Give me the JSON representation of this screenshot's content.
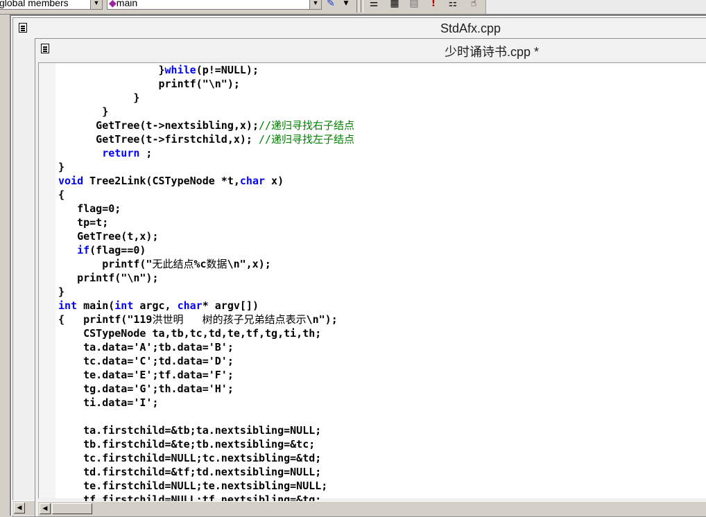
{
  "toolbar": {
    "scope_combo": "global members",
    "function_combo": "main",
    "icons": [
      "wizard-icon",
      "dropdown-arrow-icon",
      "stack-icon",
      "calculator-icon",
      "grid-icon",
      "exclamation-icon",
      "list-icon",
      "hand-icon"
    ]
  },
  "windows": {
    "back_title": "StdAfx.cpp",
    "front_title": "少时诵诗书.cpp *"
  },
  "code": {
    "lines": [
      "                }while(p!=NULL);",
      "                printf(\"\\n\");",
      "            }",
      "       }",
      "      GetTree(t->nextsibling,x);//递归寻找右子结点",
      "      GetTree(t->firstchild,x); //递归寻找左子结点",
      "       return ;",
      "}",
      "void Tree2Link(CSTypeNode *t,char x)",
      "{",
      "   flag=0;",
      "   tp=t;",
      "   GetTree(t,x);",
      "   if(flag==0)",
      "       printf(\"无此结点%c数据\\n\",x);",
      "   printf(\"\\n\");",
      "}",
      "int main(int argc, char* argv[])",
      "{   printf(\"119洪世明   树的孩子兄弟结点表示\\n\");",
      "    CSTypeNode ta,tb,tc,td,te,tf,tg,ti,th;",
      "    ta.data='A';tb.data='B';",
      "    tc.data='C';td.data='D';",
      "    te.data='E';tf.data='F';",
      "    tg.data='G';th.data='H';",
      "    ti.data='I';",
      "",
      "    ta.firstchild=&tb;ta.nextsibling=NULL;",
      "    tb.firstchild=&te;tb.nextsibling=&tc;",
      "    tc.firstchild=NULL;tc.nextsibling=&td;",
      "    td.firstchild=&tf;td.nextsibling=NULL;",
      "    te.firstchild=NULL;te.nextsibling=NULL;",
      "    tf.firstchild=NULL;tf.nextsibling=&tg;"
    ],
    "keywords": [
      "while",
      "void",
      "char",
      "if",
      "int",
      "return"
    ],
    "colors": {
      "keyword": "#0000ff",
      "comment": "#008000",
      "text": "#000000"
    }
  }
}
